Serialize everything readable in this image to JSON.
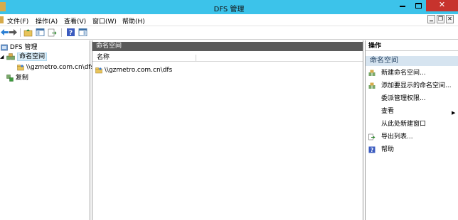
{
  "window": {
    "title": "DFS 管理"
  },
  "menu": {
    "items": [
      "文件(F)",
      "操作(A)",
      "查看(V)",
      "窗口(W)",
      "帮助(H)"
    ]
  },
  "tree": {
    "root": "DFS 管理",
    "namespaces": "命名空间",
    "namespace_path": "\\\\gzmetro.com.cn\\dfs",
    "replication": "复制"
  },
  "center": {
    "header": "命名空间",
    "column_name": "名称",
    "rows": [
      "\\\\gzmetro.com.cn\\dfs"
    ]
  },
  "actions": {
    "title": "操作",
    "section": "命名空间",
    "items": [
      {
        "label": "新建命名空间...",
        "icon": "new-namespace-icon"
      },
      {
        "label": "添加要显示的命名空间...",
        "icon": "add-namespace-icon"
      },
      {
        "label": "委派管理权限...",
        "icon": ""
      },
      {
        "label": "查看",
        "icon": "",
        "submenu": true
      },
      {
        "label": "从此处新建窗口",
        "icon": ""
      },
      {
        "label": "导出列表...",
        "icon": "export-list-icon"
      },
      {
        "label": "帮助",
        "icon": "help-icon"
      }
    ]
  },
  "colors": {
    "titlebar": "#3cc3ea",
    "close": "#c7332d",
    "pane_header": "#5b5b5b",
    "action_section": "#d6e4f0"
  }
}
